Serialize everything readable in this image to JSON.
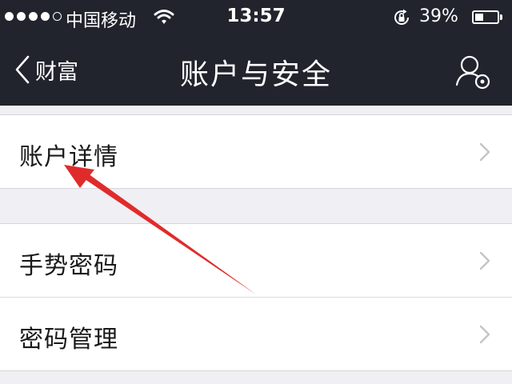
{
  "status_bar": {
    "carrier": "中国移动",
    "time": "13:57",
    "battery_percent": "39%",
    "battery_level": 0.39,
    "signal_bars": 4,
    "signal_max": 5
  },
  "nav": {
    "back_label": "财富",
    "title": "账户与安全",
    "right_icon": "user-settings-icon"
  },
  "list": {
    "group1": [
      {
        "label": "账户详情"
      }
    ],
    "group2": [
      {
        "label": "手势密码"
      },
      {
        "label": "密码管理"
      }
    ]
  },
  "colors": {
    "header_bg": "#21242d",
    "page_bg": "#efeff4",
    "annotation_arrow": "#e02b2b"
  }
}
